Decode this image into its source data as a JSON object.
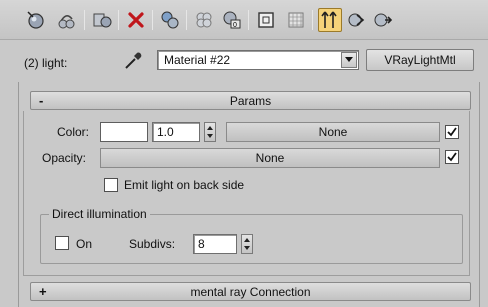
{
  "toolbar": {
    "icons": [
      "get-material-icon",
      "put-to-scene-icon",
      "assign-to-selection-icon",
      "delete-icon",
      "make-unique-icon",
      "put-to-library-icon",
      "material-id-icon",
      "show-map-icon",
      "show-background-icon",
      "go-to-parent-icon",
      "go-forward-icon",
      "navigate-icon"
    ],
    "accent_active": "#f5d37a"
  },
  "header": {
    "label": "(2) light:",
    "material_name": "Material #22",
    "type_button": "VRayLightMtl"
  },
  "params": {
    "sign": "-",
    "title": "Params",
    "color_label": "Color:",
    "color_value": "1.0",
    "color_map": "None",
    "opacity_label": "Opacity:",
    "opacity_map": "None",
    "emit_back_label": "Emit light on back side",
    "direct_illum": {
      "title": "Direct illumination",
      "on_label": "On",
      "subdivs_label": "Subdivs:",
      "subdivs_value": "8"
    }
  },
  "mental_ray": {
    "sign": "+",
    "title": "mental ray Connection"
  }
}
